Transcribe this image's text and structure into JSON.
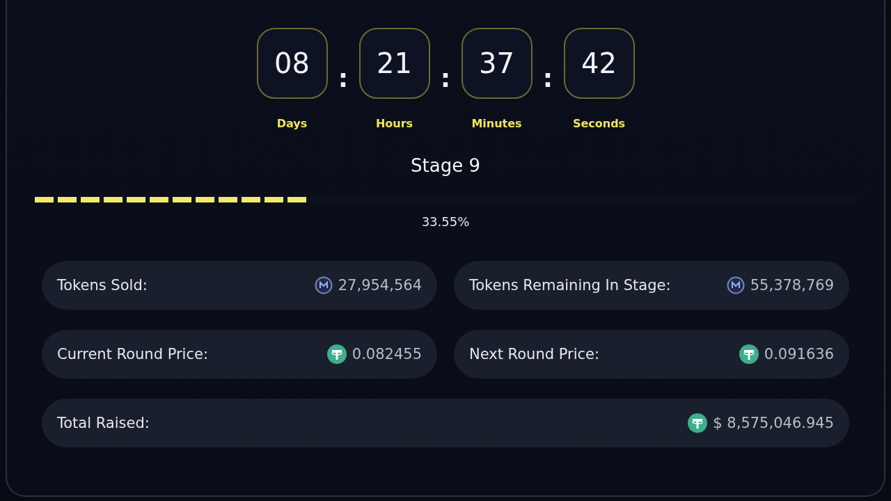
{
  "countdown": [
    {
      "value": "08",
      "label": "Days"
    },
    {
      "value": "21",
      "label": "Hours"
    },
    {
      "value": "37",
      "label": "Minutes"
    },
    {
      "value": "42",
      "label": "Seconds"
    }
  ],
  "separator": ":",
  "stage": {
    "title": "Stage 9",
    "level": 0.3355,
    "percent": "33.55%"
  },
  "stats": [
    {
      "label": "Tokens Sold:",
      "value": "27,954,564",
      "kind": "token"
    },
    {
      "label": "Tokens Remaining In Stage:",
      "value": "55,378,769",
      "kind": "token"
    },
    {
      "label": "Current Round Price:",
      "value": "0.082455",
      "kind": "usdt"
    },
    {
      "label": "Next Round Price:",
      "value": "0.091636",
      "kind": "usdt"
    }
  ],
  "total_raised": {
    "label": "Total Raised:",
    "value": "$ 8,575,046.945",
    "kind": "usdt"
  }
}
